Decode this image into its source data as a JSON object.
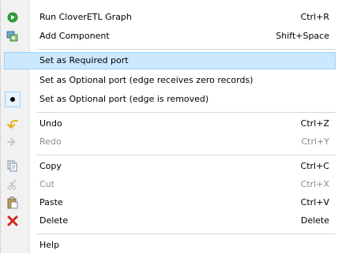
{
  "colors": {
    "run_green": "#2f9a3a",
    "delete_red": "#d2281d",
    "undo_yellow": "#e8b61a",
    "highlight": "#cce8ff"
  },
  "menu": {
    "items": [
      {
        "label": "Run CloverETL Graph",
        "shortcut": "Ctrl+R",
        "icon": "run-icon"
      },
      {
        "label": "Add Component",
        "shortcut": "Shift+Space",
        "icon": "add-component-icon"
      },
      {
        "label": "Set as Required port",
        "shortcut": "",
        "icon": ""
      },
      {
        "label": "Set as Optional port (edge receives zero records)",
        "shortcut": "",
        "icon": ""
      },
      {
        "label": "Set as Optional port (edge is removed)",
        "shortcut": "",
        "icon": "radio-selected-icon"
      },
      {
        "label": "Undo",
        "shortcut": "Ctrl+Z",
        "icon": "undo-icon"
      },
      {
        "label": "Redo",
        "shortcut": "Ctrl+Y",
        "icon": "redo-icon"
      },
      {
        "label": "Copy",
        "shortcut": "Ctrl+C",
        "icon": "copy-icon"
      },
      {
        "label": "Cut",
        "shortcut": "Ctrl+X",
        "icon": "cut-icon"
      },
      {
        "label": "Paste",
        "shortcut": "Ctrl+V",
        "icon": "paste-icon"
      },
      {
        "label": "Delete",
        "shortcut": "Delete",
        "icon": "delete-icon"
      },
      {
        "label": "Help",
        "shortcut": "",
        "icon": ""
      }
    ]
  }
}
